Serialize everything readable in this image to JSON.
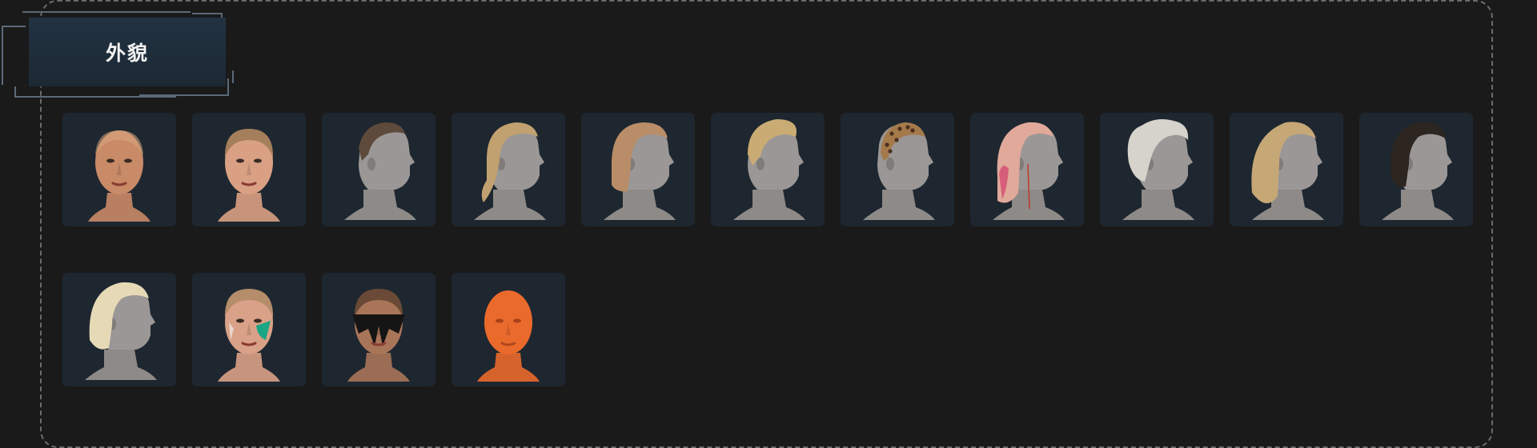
{
  "panel": {
    "title": "外貌"
  },
  "items": [
    {
      "icon": "bald-male-head-icon",
      "kind": "front",
      "skin": "#c98a68",
      "hair": "#d9a880",
      "hairStyle": "bald"
    },
    {
      "icon": "short-buzz-female-head-icon",
      "kind": "front",
      "skin": "#d9a083",
      "hair": "#a57e5b",
      "hairStyle": "buzz"
    },
    {
      "icon": "undercut-hair-icon",
      "kind": "side",
      "hair": "#5e4a3a",
      "hairStyle": "undercut"
    },
    {
      "icon": "blonde-braid-hair-icon",
      "kind": "side",
      "hair": "#c2a170",
      "hairStyle": "braid"
    },
    {
      "icon": "bob-hair-icon",
      "kind": "side",
      "hair": "#b98d68",
      "hairStyle": "bob"
    },
    {
      "icon": "blonde-pompadour-hair-icon",
      "kind": "side",
      "hair": "#c9ab73",
      "hairStyle": "pomp"
    },
    {
      "icon": "leopard-buzz-hair-icon",
      "kind": "side",
      "hair": "#a57a4b",
      "hairStyle": "leopard"
    },
    {
      "icon": "pink-ponytail-hair-icon",
      "kind": "side",
      "hair": "#e0a99a",
      "hairStyle": "pink"
    },
    {
      "icon": "white-spiky-hair-icon",
      "kind": "side",
      "hair": "#d6d2cc",
      "hairStyle": "spiky"
    },
    {
      "icon": "long-blonde-hair-icon",
      "kind": "side",
      "hair": "#c6a776",
      "hairStyle": "long"
    },
    {
      "icon": "black-shaggy-hair-icon",
      "kind": "side",
      "hair": "#2c2520",
      "hairStyle": "shag"
    },
    {
      "icon": "platinum-wavy-hair-icon",
      "kind": "side",
      "hair": "#e6d9b6",
      "hairStyle": "wavy"
    },
    {
      "icon": "face-paint-green-icon",
      "kind": "front",
      "skin": "#d9a187",
      "hair": "#b58d6a",
      "hairStyle": "paintgreen"
    },
    {
      "icon": "face-paint-black-mask-icon",
      "kind": "front",
      "skin": "#a97559",
      "hair": "#6a4a36",
      "hairStyle": "mask"
    },
    {
      "icon": "orange-skin-head-icon",
      "kind": "front",
      "skin": "#ea6a2c",
      "hair": "#ea6a2c",
      "hairStyle": "orange"
    }
  ]
}
